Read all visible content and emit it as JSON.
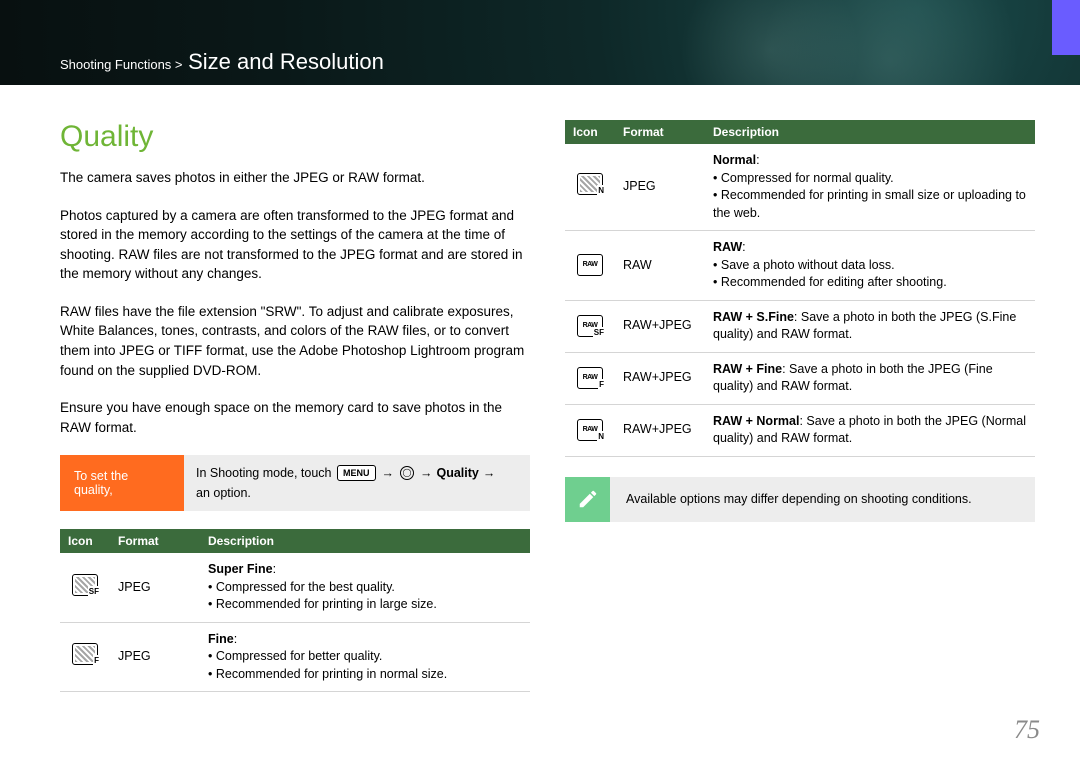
{
  "header": {
    "breadcrumb_prefix": "Shooting Functions >",
    "breadcrumb_title": "Size and Resolution"
  },
  "main": {
    "heading": "Quality",
    "paragraphs": [
      "The camera saves photos in either the JPEG or RAW format.",
      "Photos captured by a camera are often transformed to the JPEG format and stored in the memory according to the settings of the camera at the time of shooting. RAW files are not transformed to the JPEG format and are stored in the memory without any changes.",
      "RAW files have the file extension \"SRW\". To adjust and calibrate exposures, White Balances, tones, contrasts, and colors of the RAW files, or to convert them into JPEG or TIFF format, use the Adobe Photoshop Lightroom program found on the supplied DVD-ROM.",
      "Ensure you have enough space on the memory card to save photos in the RAW format."
    ],
    "setbox": {
      "label": "To set the quality,",
      "instr_prefix": "In Shooting mode, touch",
      "menu_label": "MENU",
      "quality_label": "Quality",
      "instr_suffix": "an option."
    },
    "table_headers": {
      "icon": "Icon",
      "format": "Format",
      "description": "Description"
    },
    "left_rows": [
      {
        "icon": {
          "checker": true,
          "sub": "SF",
          "label": ""
        },
        "format": "JPEG",
        "title": "Super Fine",
        "bullets": [
          "Compressed for the best quality.",
          "Recommended for printing in large size."
        ]
      },
      {
        "icon": {
          "checker": true,
          "sub": "F",
          "label": ""
        },
        "format": "JPEG",
        "title": "Fine",
        "bullets": [
          "Compressed for better quality.",
          "Recommended for printing in normal size."
        ]
      }
    ],
    "right_rows": [
      {
        "icon": {
          "checker": true,
          "sub": "N",
          "label": ""
        },
        "format": "JPEG",
        "title": "Normal",
        "bullets": [
          "Compressed for normal quality.",
          "Recommended for printing in small size or uploading to the web."
        ]
      },
      {
        "icon": {
          "checker": false,
          "sub": "",
          "label": "RAW"
        },
        "format": "RAW",
        "title": "RAW",
        "bullets": [
          "Save a photo without data loss.",
          "Recommended for editing after shooting."
        ]
      },
      {
        "icon": {
          "checker": false,
          "sub": "SF",
          "label": "RAW"
        },
        "format": "RAW+JPEG",
        "title": "RAW + S.Fine",
        "after": ": Save a photo in both the JPEG (S.Fine quality) and RAW format.",
        "bullets": []
      },
      {
        "icon": {
          "checker": false,
          "sub": "F",
          "label": "RAW"
        },
        "format": "RAW+JPEG",
        "title": "RAW + Fine",
        "after": ": Save a photo in both the JPEG (Fine quality) and RAW format.",
        "bullets": []
      },
      {
        "icon": {
          "checker": false,
          "sub": "N",
          "label": "RAW"
        },
        "format": "RAW+JPEG",
        "title": "RAW + Normal",
        "after": ": Save a photo in both the JPEG (Normal quality) and RAW format.",
        "bullets": []
      }
    ],
    "note": "Available options may differ depending on shooting conditions."
  },
  "page_number": "75"
}
